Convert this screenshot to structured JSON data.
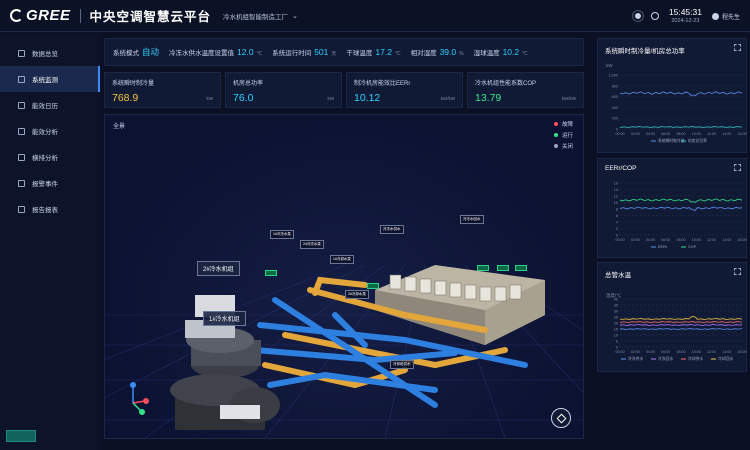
{
  "header": {
    "brand": "GREE",
    "platform_title": "中央空调智慧云平台",
    "plant_name": "冷水机组智能制造工厂",
    "time": "15:45:31",
    "date": "2024-12-23",
    "user": "程先生"
  },
  "sidebar": {
    "items": [
      {
        "label": "数据总览",
        "icon": "dashboard-icon"
      },
      {
        "label": "系统监测",
        "icon": "monitor-icon"
      },
      {
        "label": "能效日历",
        "icon": "calendar-icon"
      },
      {
        "label": "能效分析",
        "icon": "chart-icon"
      },
      {
        "label": "横排分析",
        "icon": "analysis-icon"
      },
      {
        "label": "报警事件",
        "icon": "alarm-icon"
      },
      {
        "label": "报告报表",
        "icon": "report-icon"
      }
    ],
    "active_index": 1
  },
  "status": {
    "mode_label": "系统模式",
    "mode_value": "自动",
    "setpoint_label": "冷冻水供水温度设置值",
    "setpoint_value": "12.0",
    "setpoint_unit": "℃",
    "runtime_label": "系统运行时间",
    "runtime_value": "501",
    "runtime_unit": "天",
    "drybulb_label": "干球温度",
    "drybulb_value": "17.2",
    "drybulb_unit": "℃",
    "humidity_label": "相对湿度",
    "humidity_value": "39.0",
    "humidity_unit": "%",
    "wetbulb_label": "湿球温度",
    "wetbulb_value": "10.2",
    "wetbulb_unit": "℃"
  },
  "kpis": [
    {
      "label": "系统瞬时制冷量",
      "value": "768.9",
      "unit": "kW",
      "color": "#f5c542"
    },
    {
      "label": "机房总功率",
      "value": "76.0",
      "unit": "kW",
      "color": "#2fd1ff"
    },
    {
      "label": "制冷机房能效比EERr",
      "value": "10.12",
      "unit": "kW/kW",
      "color": "#2fd1ff"
    },
    {
      "label": "冷水机组性能系数COP",
      "value": "13.79",
      "unit": "kW/kW",
      "color": "#3ee58f"
    }
  ],
  "scene": {
    "view_label": "全景",
    "legend": [
      {
        "label": "故障",
        "color": "#ff4d5e"
      },
      {
        "label": "运行",
        "color": "#33e08a"
      },
      {
        "label": "关闭",
        "color": "#9aa6c2"
      }
    ],
    "chiller_label_1": "1#冷水机组",
    "chiller_label_2": "2#冷水机组",
    "valve_labels": [
      "1#冷冻水泵",
      "2#冷冻水泵",
      "1#冷却水泵",
      "2#冷却水泵",
      "冷却塔供水",
      "冷冻水供水",
      "冷冻水回水"
    ]
  },
  "right_panels": {
    "p1": {
      "title": "系统瞬时制冷量/机房总功率",
      "unit": "kW",
      "legend": [
        "系统瞬时制冷量",
        "机房总功率"
      ],
      "xticks": [
        "00:00",
        "02:00",
        "04:00",
        "06:00",
        "08:00",
        "10:00",
        "12:00",
        "14:00",
        "16:00"
      ],
      "yticks": [
        "1,000",
        "800",
        "600",
        "400",
        "200",
        "0"
      ]
    },
    "p2": {
      "title": "EERr/COP",
      "legend": [
        "EERr",
        "COP"
      ],
      "xticks": [
        "00:00",
        "02:00",
        "04:00",
        "06:00",
        "08:00",
        "10:00",
        "12:00",
        "14:00",
        "16:00"
      ],
      "yticks": [
        "16",
        "14",
        "12",
        "10",
        "8",
        "6",
        "4",
        "2",
        "0"
      ]
    },
    "p3": {
      "title": "总管水温",
      "unit": "温度/℃",
      "legend": [
        "冷冻供水",
        "冷冻回水",
        "冷却供水",
        "冷却回水"
      ],
      "xticks": [
        "00:00",
        "02:00",
        "04:00",
        "06:00",
        "08:00",
        "10:00",
        "12:00",
        "14:00",
        "16:00"
      ],
      "yticks": [
        "40",
        "35",
        "30",
        "25",
        "20",
        "15",
        "10",
        "5",
        "0"
      ]
    }
  },
  "colors": {
    "accent": "#3b8dff",
    "cyan": "#2fd1ff",
    "yellow_pipe": "#e3a63a",
    "blue_pipe": "#2d7fe0"
  }
}
